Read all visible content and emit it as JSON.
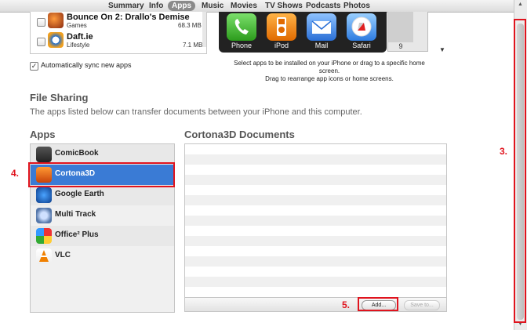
{
  "tabs": [
    "Summary",
    "Info",
    "Apps",
    "Music",
    "Movies",
    "TV Shows",
    "Podcasts",
    "Photos"
  ],
  "active_tab": "Apps",
  "top_apps": [
    {
      "name": "Bounce On 2: Drallo's Demise",
      "category": "Games",
      "size": "68.3 MB"
    },
    {
      "name": "Daft.ie",
      "category": "Lifestyle",
      "size": "7.1 MB"
    }
  ],
  "autosync_label": "Automatically sync new apps",
  "dock_apps": [
    "Phone",
    "iPod",
    "Mail",
    "Safari"
  ],
  "page_number": "9",
  "hint": {
    "line1": "Select apps to be installed on your iPhone or drag to a specific home screen.",
    "line2": "Drag to rearrange app icons or home screens."
  },
  "file_sharing": {
    "heading": "File Sharing",
    "description": "The apps listed below can transfer documents between your iPhone and this computer.",
    "apps_heading": "Apps",
    "apps": [
      "ComicBook",
      "Cortona3D",
      "Google Earth",
      "Multi Track",
      "Office² Plus",
      "VLC"
    ],
    "selected_app": "Cortona3D",
    "documents_heading": "Cortona3D Documents",
    "add_button": "Add...",
    "save_button": "Save to..."
  },
  "annotations": [
    "3.",
    "4.",
    "5."
  ],
  "colors": {
    "accent": "#3a7bd5",
    "annotation": "#e0141e"
  }
}
